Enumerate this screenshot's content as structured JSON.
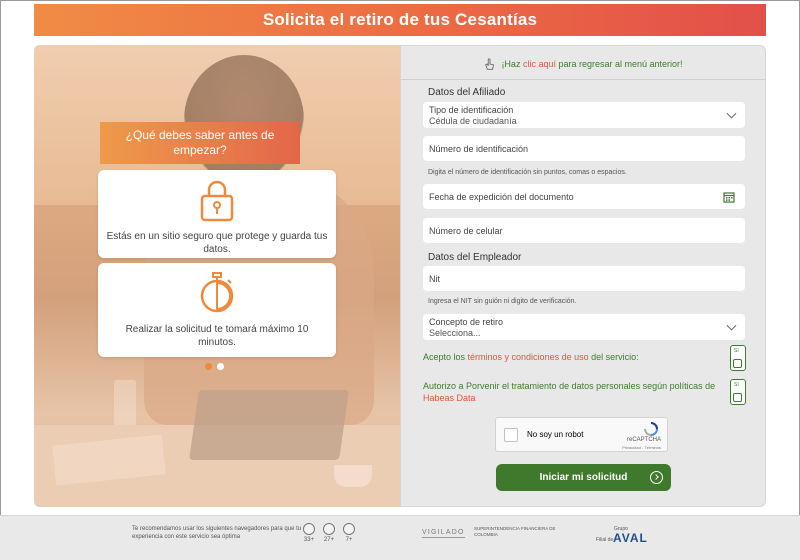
{
  "header": {
    "title": "Solicita el retiro de tus Cesantías"
  },
  "info": {
    "title": "¿Qué debes saber antes de empezar?",
    "cards": [
      {
        "text": "Estás en un sitio seguro que protege y guarda tus datos.",
        "icon": "lock-icon"
      },
      {
        "text": "Realizar la solicitud te tomará máximo 10 minutos.",
        "icon": "stopwatch-icon"
      }
    ],
    "carousel": {
      "total": 2,
      "active": 1
    }
  },
  "back": {
    "prefix": "¡Haz ",
    "link": "clic aquí",
    "suffix": " para regresar al menú anterior!"
  },
  "form": {
    "affiliate_title": "Datos del Afiliado",
    "id_type_label": "Tipo de identificación",
    "id_type_value": "Cédula de ciudadanía",
    "id_number_placeholder": "Número de identificación",
    "id_number_hint": "Digita el número de identificación sin puntos, comas o espacios.",
    "issue_date_placeholder": "Fecha de expedición del documento",
    "mobile_placeholder": "Número de celular",
    "employer_title": "Datos del Empleador",
    "nit_placeholder": "Nit",
    "nit_hint": "Ingresa el NIT sin guión ni digito de verificación.",
    "concept_label": "Concepto de retiro",
    "concept_value": "Selecciona...",
    "terms_prefix": "Acepto los ",
    "terms_link": "términos y condiciones de uso",
    "terms_suffix": " del servicio:",
    "data_prefix": "Autorizo a Porvenir el tratamiento de datos personales según políticas de ",
    "data_link": "Habeas Data",
    "toggle_label": "Sí",
    "captcha_text": "No soy un robot",
    "captcha_brand": "reCAPTCHA",
    "captcha_terms": "Privacidad - Términos",
    "submit_label": "Iniciar mi solicitud"
  },
  "footer": {
    "note": "Te recomendamos usar los siguientes navegadores para que tu experiencia con este servicio sea óptima",
    "browsers": [
      {
        "version": "33+"
      },
      {
        "version": "27+"
      },
      {
        "version": "7+"
      }
    ],
    "vigilado": "VIGILADO",
    "superintendencia": "SUPERINTENDENCIA FINANCIERA DE COLOMBIA",
    "grupo": "Grupo",
    "filial": "Filial de",
    "aval": "AVAL"
  },
  "colors": {
    "orange": "#ee8a3c",
    "green": "#3f7a2c",
    "red": "#e0543c",
    "aval_blue": "#1d4f91"
  }
}
